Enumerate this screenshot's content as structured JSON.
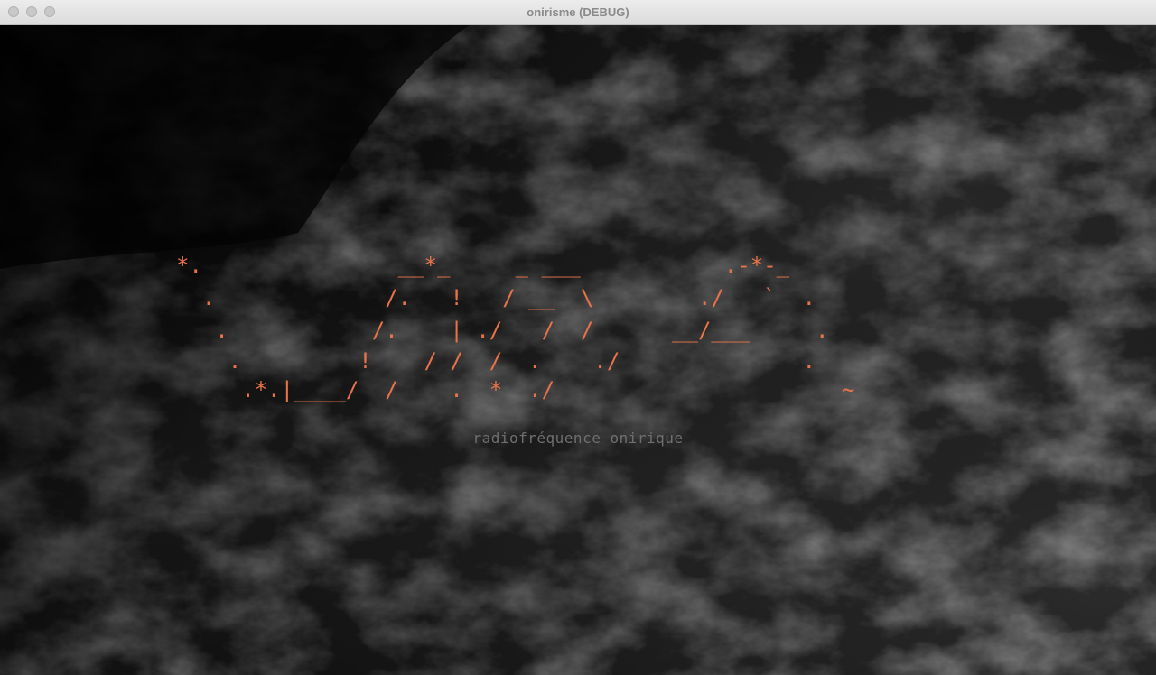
{
  "window": {
    "title": "onirisme (DEBUG)"
  },
  "colors": {
    "accent": "#e8734a",
    "subtitle": "#6f6f6f",
    "background": "#141414"
  },
  "logo": {
    "ascii_lines": [
      "*.               __*_     _ ___           .-*-_",
      "  .             /.   !   / __  \\        ./   `  .",
      "   .           /.    | ./   /  /      __/___     .",
      "    .         !    / /  /  .    ./              .",
      "     .*.|____/  /    .  *  ./                      ~"
    ]
  },
  "subtitle": "radiofréquence onirique"
}
